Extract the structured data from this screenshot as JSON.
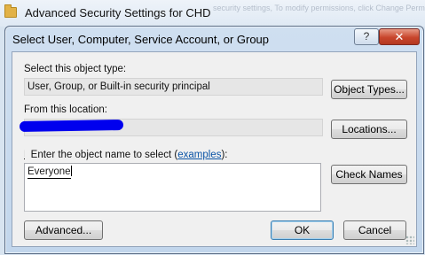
{
  "parent_window": {
    "title": "Advanced Security Settings for CHD",
    "ghost_text": "security settings, To modify permissions, click Change Permissions"
  },
  "dialog": {
    "title": "Select User, Computer, Service Account, or Group",
    "help_label": "?",
    "close_label": "✕"
  },
  "object_type": {
    "label": "Select this object type:",
    "value": "User, Group, or Built-in security principal",
    "button": "Object Types..."
  },
  "location": {
    "label": "From this location:",
    "value": "",
    "button": "Locations..."
  },
  "object_name": {
    "label_prefix": "Enter the object name to select (",
    "label_link": "examples",
    "label_suffix": "):",
    "value": "Everyone",
    "check_button": "Check Names"
  },
  "footer": {
    "advanced": "Advanced...",
    "ok": "OK",
    "cancel": "Cancel"
  }
}
